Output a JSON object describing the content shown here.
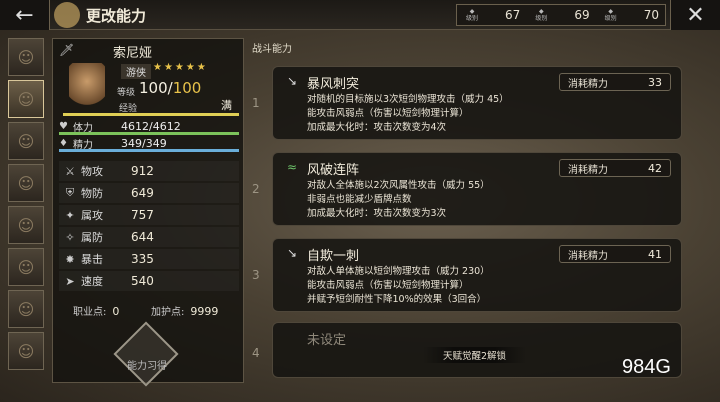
{
  "header": {
    "back_icon": "←",
    "title": "更改能力",
    "levels": [
      {
        "icon": "rank-1-icon",
        "label": "级别",
        "value": "67"
      },
      {
        "icon": "rank-2-icon",
        "label": "级别",
        "value": "69"
      },
      {
        "icon": "rank-3-icon",
        "label": "级别",
        "value": "70"
      }
    ],
    "close_icon": "✕"
  },
  "character": {
    "name": "索尼娅",
    "job": "游侠",
    "stars": "★★★★★",
    "level_label": "等级",
    "level": "100",
    "level_max": "100",
    "exp_label": "经验",
    "exp_status": "满",
    "hp_label": "体力",
    "hp": "4612/4612",
    "sp_label": "精力",
    "sp": "349/349",
    "stats": [
      {
        "label": "物攻",
        "value": "912"
      },
      {
        "label": "物防",
        "value": "649"
      },
      {
        "label": "属攻",
        "value": "757"
      },
      {
        "label": "属防",
        "value": "644"
      },
      {
        "label": "暴击",
        "value": "335"
      },
      {
        "label": "速度",
        "value": "540"
      }
    ],
    "job_points_label": "职业点:",
    "job_points": "0",
    "bonus_points_label": "加护点:",
    "bonus_points": "9999",
    "ability_button_label": "能力习得"
  },
  "skills": {
    "section_title": "战斗能力",
    "cost_label": "消耗精力",
    "items": [
      {
        "num": "1",
        "name": "暴风刺突",
        "cost": "33",
        "desc": [
          "对随机的目标施以3次短剑物理攻击（威力 45）",
          "能攻击风弱点（伤害以短剑物理计算）",
          "加成最大化时：攻击次数变为4次"
        ]
      },
      {
        "num": "2",
        "name": "风破连阵",
        "cost": "42",
        "desc": [
          "对敌人全体施以2次风属性攻击（威力 55）",
          "非弱点也能减少盾牌点数",
          "加成最大化时：攻击次数变为3次"
        ]
      },
      {
        "num": "3",
        "name": "自欺一刺",
        "cost": "41",
        "desc": [
          "对敌人单体施以短剑物理攻击（威力 230）",
          "能攻击风弱点（伤害以短剑物理计算）",
          "并赋予短剑耐性下降10%的效果（3回合）"
        ]
      },
      {
        "num": "4",
        "name": "未设定",
        "unlock": "天赋觉醒2解锁"
      }
    ]
  },
  "watermark": "984G"
}
